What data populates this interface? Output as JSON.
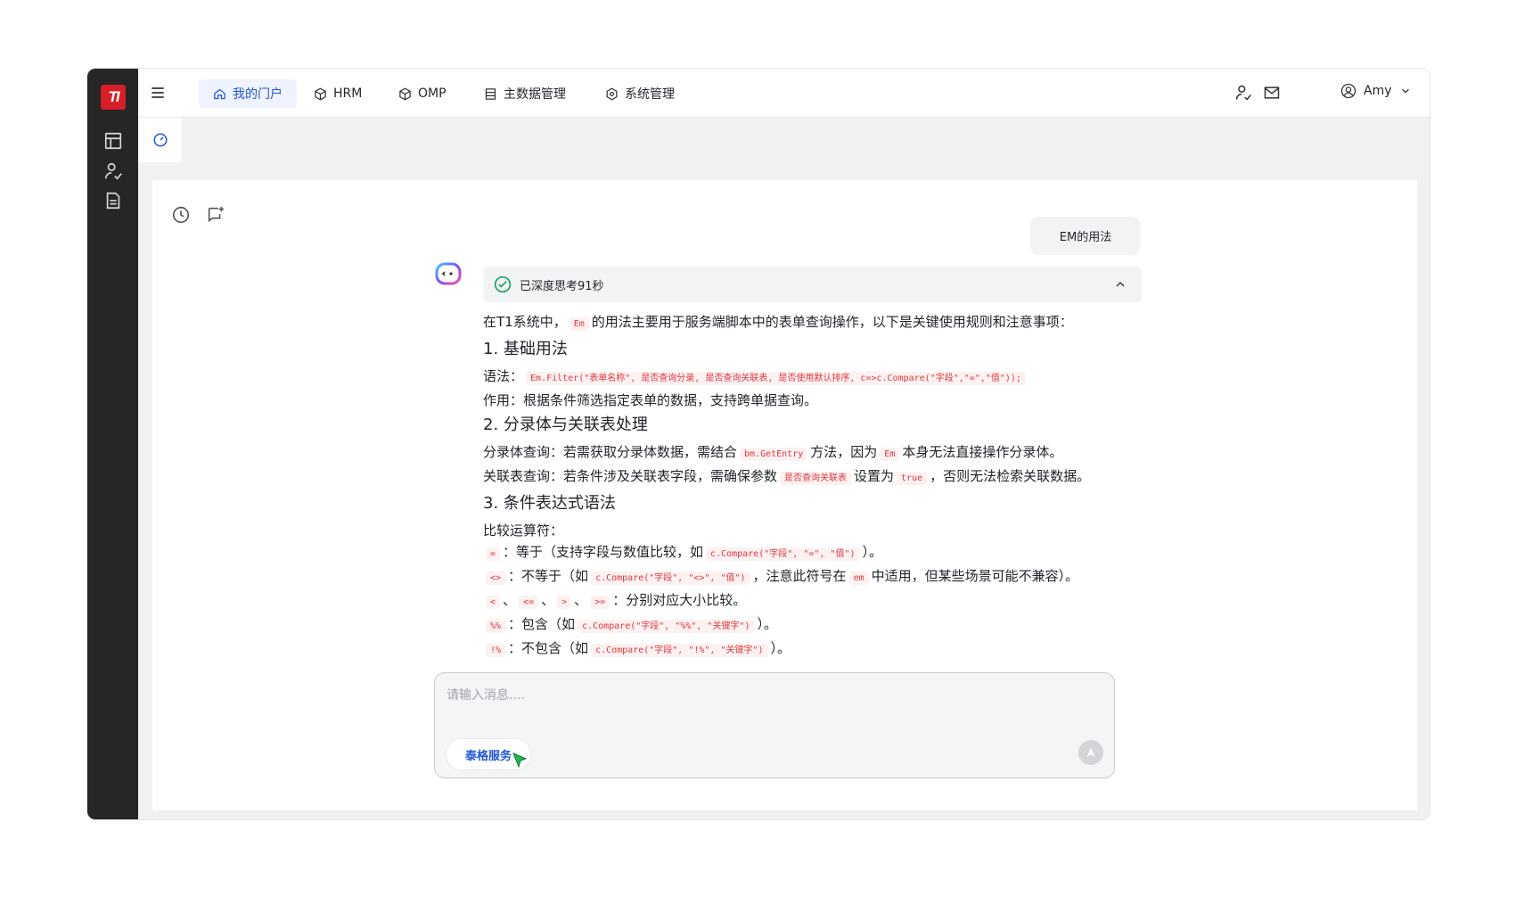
{
  "sidebar": {
    "logo": "TI",
    "items": [
      "layout-icon",
      "user-check-icon",
      "document-icon"
    ]
  },
  "nav": {
    "items": [
      {
        "label": "我的门户",
        "icon": "home-icon",
        "active": true
      },
      {
        "label": "HRM",
        "icon": "cube-icon"
      },
      {
        "label": "OMP",
        "icon": "cube-icon"
      },
      {
        "label": "主数据管理",
        "icon": "table-icon"
      },
      {
        "label": "系统管理",
        "icon": "gear-icon"
      }
    ],
    "user": "Amy"
  },
  "chat": {
    "user_message": "EM的用法",
    "thinking": "已深度思考91秒",
    "answer": {
      "intro_pre": "在T1系统中，",
      "intro_code": "Em",
      "intro_post": "的用法主要用于服务端脚本中的表单查询操作，以下是关键使用规则和注意事项：",
      "h1": "1. 基础用法",
      "syntax_label": "语法：",
      "syntax_code": "Em.Filter(\"表单名称\", 是否查询分录, 是否查询关联表, 是否使用默认排序, c=>c.Compare(\"字段\",\"=\",\"值\"));",
      "purpose": "作用：根据条件筛选指定表单的数据，支持跨单据查询。",
      "h2": "2. 分录体与关联表处理",
      "entry_pre": "分录体查询：若需获取分录体数据，需结合",
      "entry_code1": "bm.GetEntry",
      "entry_mid": "方法，因为",
      "entry_code2": "Em",
      "entry_post": "本身无法直接操作分录体。",
      "rel_pre": "关联表查询：若条件涉及关联表字段，需确保参数",
      "rel_code1": "是否查询关联表",
      "rel_mid": "设置为",
      "rel_code2": "true",
      "rel_post": "，否则无法检索关联数据。",
      "h3": "3. 条件表达式语法",
      "ops_label": "比较运算符：",
      "op1_code": "=",
      "op1_pre": "：等于（支持字段与数值比较，如",
      "op1_code2": "c.Compare(\"字段\", \"=\", \"值\")",
      "op1_post": "）。",
      "op2_code": "<>",
      "op2_pre": "：不等于（如",
      "op2_code2": "c.Compare(\"字段\", \"<>\", \"值\")",
      "op2_mid": "，注意此符号在",
      "op2_code3": "em",
      "op2_post": "中适用，但某些场景可能不兼容）。",
      "op3_codes": [
        "<",
        "<=",
        ">",
        ">="
      ],
      "op3_sep": "、",
      "op3_post": "：分别对应大小比较。",
      "op4_code": "%%",
      "op4_pre": "：包含（如",
      "op4_code2": "c.Compare(\"字段\", \"%%\", \"关键字\")",
      "op4_post": "）。",
      "op5_code": "!%",
      "op5_pre": "：不包含（如",
      "op5_code2": "c.Compare(\"字段\", \"!%\", \"关键字\")",
      "op5_post": "）。"
    },
    "input_placeholder": "请输入消息....",
    "service_chip": "泰格服务"
  }
}
